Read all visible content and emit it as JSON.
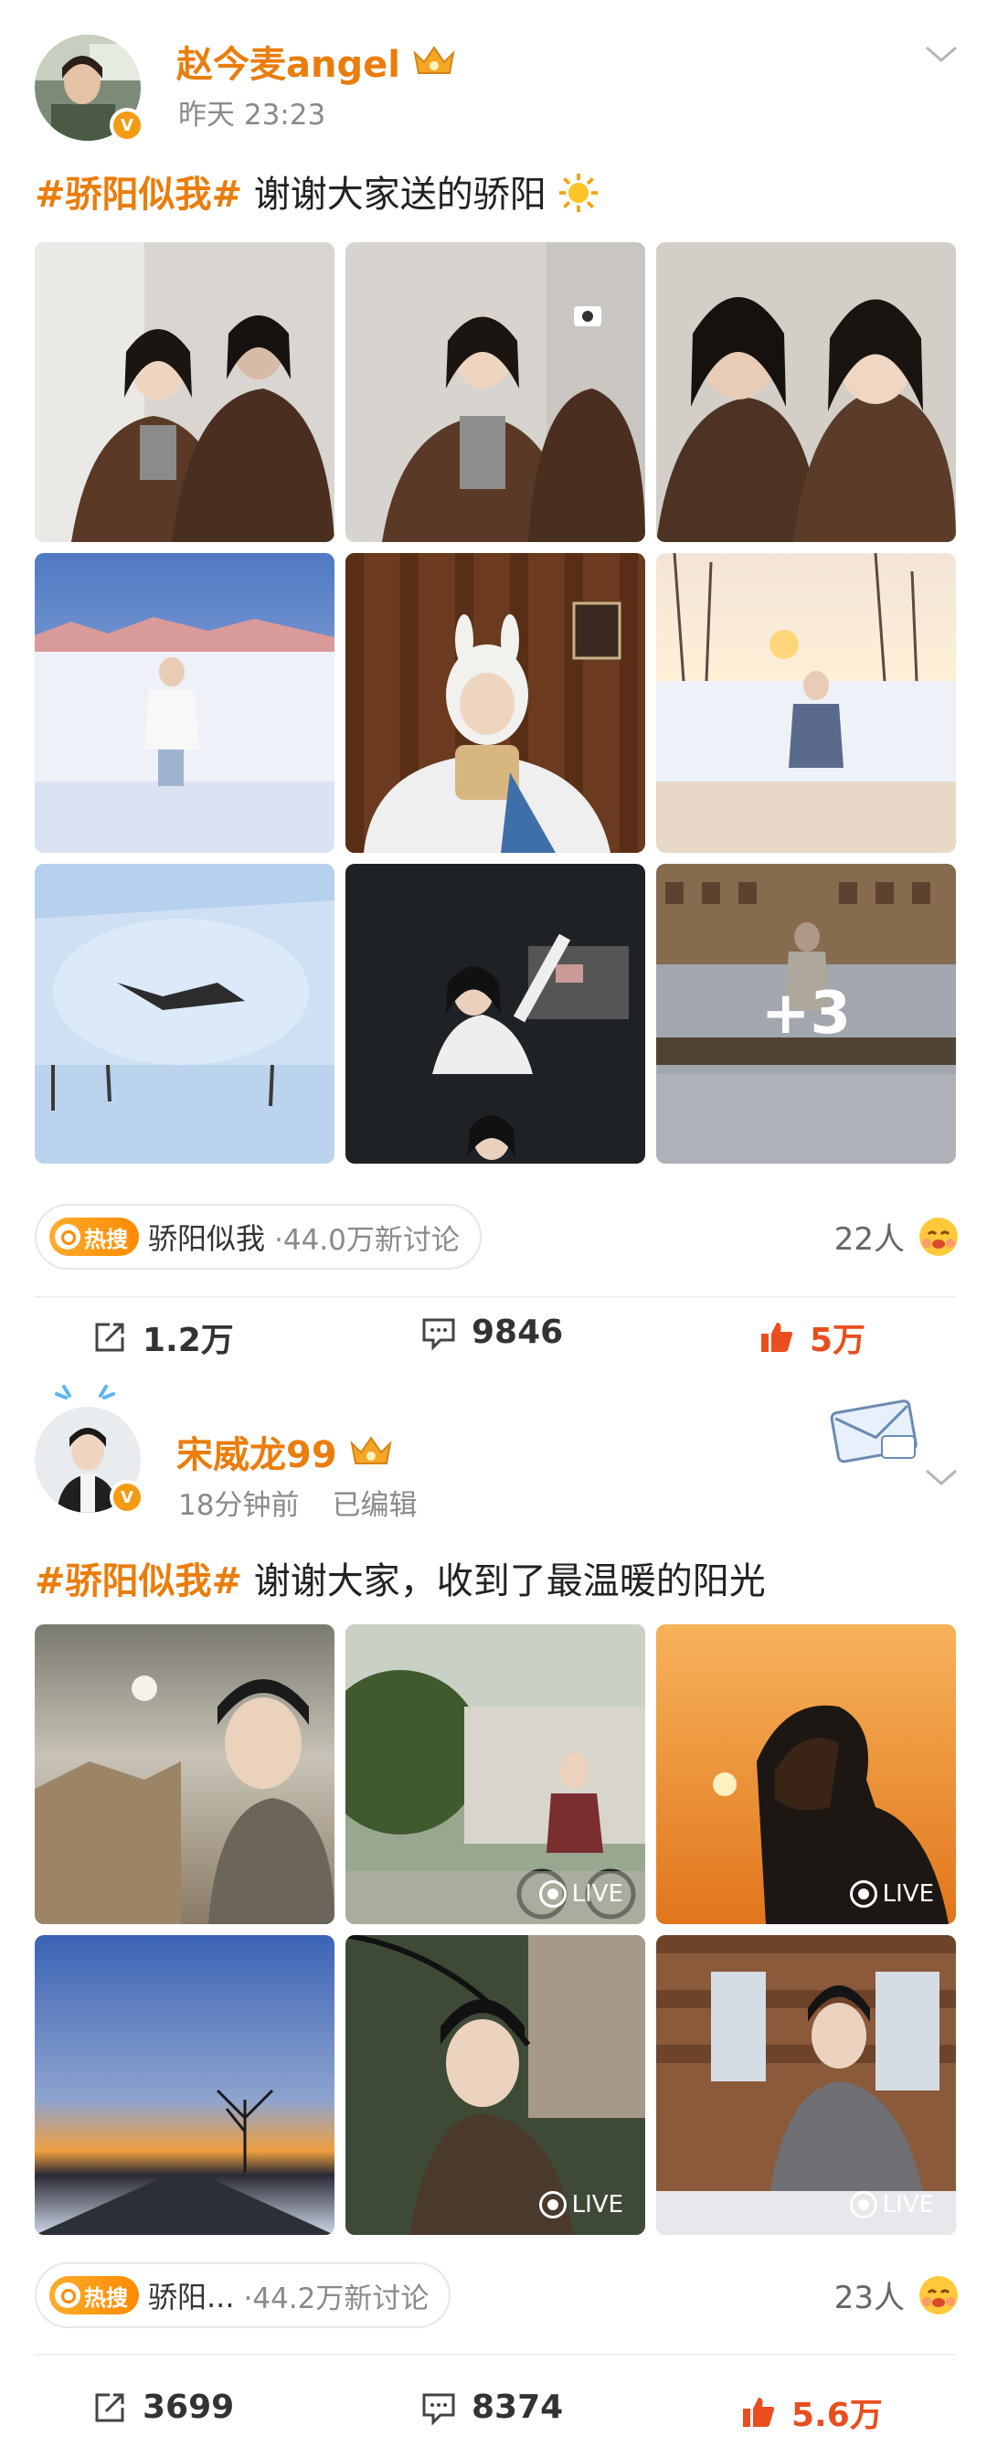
{
  "posts": [
    {
      "username": "赵今麦angel",
      "time": "昨天 23:23",
      "edited": "",
      "hashtag": "#骄阳似我#",
      "text": " 谢谢大家送的骄阳",
      "more_overlay": "+3",
      "topic": {
        "hot": "热搜",
        "name": "骄阳似我",
        "discussions": "·44.0万新讨论"
      },
      "people": "22人",
      "actions": {
        "repost": "1.2万",
        "comment": "9846",
        "like": "5万"
      }
    },
    {
      "username": "宋威龙99",
      "time": "18分钟前",
      "edited": "已编辑",
      "hashtag": "#骄阳似我#",
      "text": " 谢谢大家，收到了最温暖的阳光",
      "live_label": "LIVE",
      "topic": {
        "hot": "热搜",
        "name": "骄阳...",
        "discussions": "·44.2万新讨论"
      },
      "people": "23人",
      "actions": {
        "repost": "3699",
        "comment": "8374",
        "like": "5.6万"
      }
    }
  ],
  "colors": {
    "accent": "#ea7d0c",
    "like": "#ea4e1e",
    "hot": "#ff8a00"
  },
  "icons": [
    "crown-icon",
    "verified-icon",
    "chevron-down-icon",
    "repost-icon",
    "comment-icon",
    "like-icon",
    "search-icon",
    "live-icon",
    "sun-emoji",
    "envelope-sticker"
  ]
}
